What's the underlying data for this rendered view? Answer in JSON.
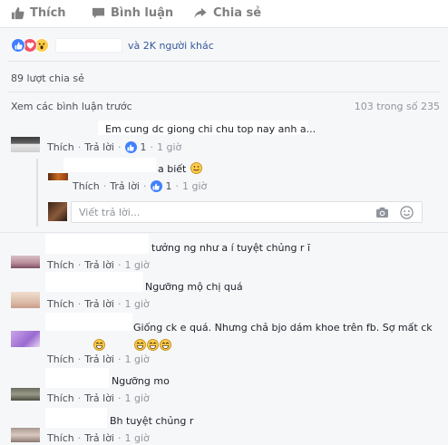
{
  "actions": {
    "like_label": "Thích",
    "comment_label": "Bình luận",
    "share_label": "Chia sẻ"
  },
  "reactions": {
    "icons": [
      "like-icon",
      "love-icon",
      "wow-icon"
    ],
    "summary_text": "và 2K người khác"
  },
  "shares": {
    "text": "89 lượt chia sẻ"
  },
  "comments_header": {
    "prev_text": "Xem các bình luận trước",
    "count_text": "103 trong số 235"
  },
  "comments": [
    {
      "text": "Em cung dc giong chi chu top nay anh a...",
      "like": "Thích",
      "reply": "Trả lời",
      "likes": "1",
      "time": "1 giờ"
    },
    {
      "text": "tưởng ng như a í tuyệt chủng r ī",
      "like": "Thích",
      "reply": "Trả lời",
      "time": "1 giờ"
    },
    {
      "text": "Ngưỡng mộ chị quá",
      "like": "Thích",
      "reply": "Trả lời",
      "time": "1 giờ"
    },
    {
      "text": "Giống ck e quá. Nhưng chả bjo dám khoe trên fb. Sợ mất ck",
      "like": "Thích",
      "reply": "Trả lời",
      "time": "1 giờ"
    },
    {
      "text": "Ngưỡng mo",
      "like": "Thích",
      "reply": "Trả lời",
      "time": "1 giờ"
    },
    {
      "text": "Bh tuyệt chủng r",
      "like": "Thích",
      "reply": "Trả lời",
      "time": "1 giờ"
    }
  ],
  "reply": {
    "text": "a biết",
    "like": "Thích",
    "reply": "Trả lời",
    "likes": "1",
    "time": "1 giờ"
  },
  "reply_input": {
    "placeholder": "Viết trả lời..."
  },
  "colors": {
    "facebook_blue": "#4080ff",
    "link_blue": "#365899",
    "love_red": "#f25268",
    "emoji_yellow": "#ffcc4d"
  }
}
